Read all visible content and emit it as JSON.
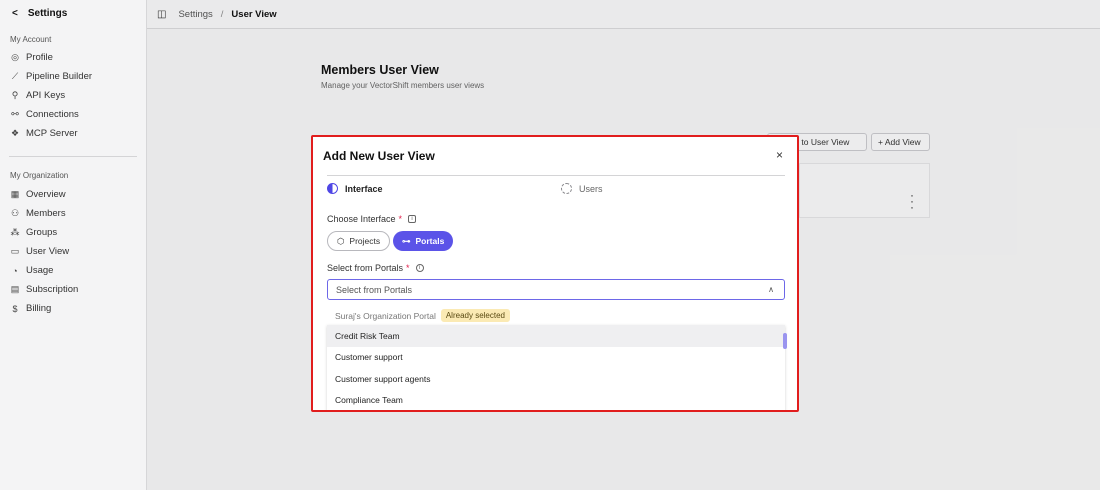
{
  "sidebar": {
    "back_label": "Settings",
    "account_section": "My Account",
    "account_items": [
      {
        "label": "Profile",
        "icon": "user-circle-icon"
      },
      {
        "label": "Pipeline Builder",
        "icon": "wand-icon"
      },
      {
        "label": "API Keys",
        "icon": "key-icon"
      },
      {
        "label": "Connections",
        "icon": "plug-icon"
      },
      {
        "label": "MCP Server",
        "icon": "server-icon"
      }
    ],
    "org_section": "My Organization",
    "org_items": [
      {
        "label": "Overview",
        "icon": "grid-icon"
      },
      {
        "label": "Members",
        "icon": "users-icon"
      },
      {
        "label": "Groups",
        "icon": "group-icon"
      },
      {
        "label": "User View",
        "icon": "monitor-icon"
      },
      {
        "label": "Usage",
        "icon": "gauge-icon"
      },
      {
        "label": "Subscription",
        "icon": "card-icon"
      },
      {
        "label": "Billing",
        "icon": "dollar-icon"
      }
    ]
  },
  "breadcrumb": {
    "root": "Settings",
    "separator": "/",
    "current": "User View"
  },
  "page": {
    "title": "Members User View",
    "subtitle": "Manage your VectorShift members user views",
    "switch_button": "Switch to User View",
    "add_button": "+ Add View"
  },
  "modal": {
    "title": "Add New User View",
    "close": "×",
    "steps": [
      {
        "label": "Interface"
      },
      {
        "label": "Users"
      }
    ],
    "interface_label": "Choose Interface",
    "required_mark": "*",
    "interface_options": [
      {
        "label": "Projects",
        "icon": "⬡",
        "selected": false
      },
      {
        "label": "Portals",
        "icon": "⊶",
        "selected": true
      }
    ],
    "portals_label": "Select from Portals",
    "portals_placeholder": "Select from Portals",
    "selected_portal": "Suraj's Organization Portal",
    "selected_badge": "Already selected",
    "portal_options": [
      "Credit Risk Team",
      "Customer support",
      "Customer support agents",
      "Compliance Team"
    ]
  },
  "colors": {
    "accent": "#5b53e8",
    "highlight_border": "#e11d1d",
    "badge_bg": "#fbeab4"
  }
}
